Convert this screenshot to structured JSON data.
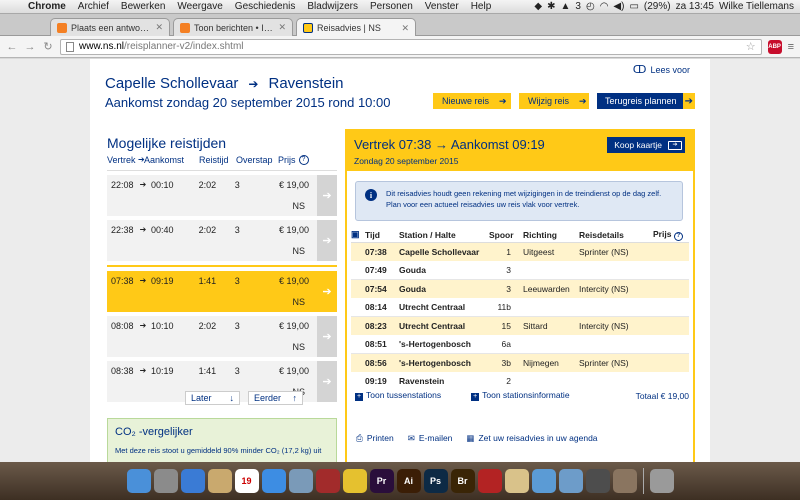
{
  "menubar": {
    "items": [
      "Chrome",
      "Archief",
      "Bewerken",
      "Weergave",
      "Geschiedenis",
      "Bladwijzers",
      "Personen",
      "Venster",
      "Help"
    ],
    "battery": "(29%)",
    "clock": "za 13:45",
    "user": "Wilke Tiellemans",
    "badge_count": "3"
  },
  "tabs": [
    {
      "title": "Plaats een antwoord • Bok",
      "favicon": "stackoverflow-icon",
      "active": false
    },
    {
      "title": "Toon berichten • Instelling",
      "favicon": "stackoverflow-icon",
      "active": false
    },
    {
      "title": "Reisadvies | NS",
      "favicon": "ns-icon",
      "active": true
    }
  ],
  "address": {
    "host": "www.ns.nl",
    "path": "/reisplanner-v2/index.shtml",
    "abp_label": "ABP"
  },
  "page": {
    "lees_voor": "Lees voor",
    "from": "Capelle Schollevaar",
    "to": "Ravenstein",
    "arrival": "Aankomst zondag 20 september 2015 rond 10:00",
    "buttons": {
      "nieuwe": "Nieuwe reis",
      "wijzig": "Wijzig reis",
      "terug": "Terugreis plannen"
    },
    "left": {
      "title": "Mogelijke reistijden",
      "heads": {
        "vertrek": "Vertrek",
        "aankomst": "Aankomst",
        "reistijd": "Reistijd",
        "overstap": "Overstap",
        "prijs": "Prijs"
      },
      "options": [
        {
          "dep": "22:08",
          "arr": "00:10",
          "time": "2:02",
          "transfers": "3",
          "price": "€ 19,00",
          "op": "NS"
        },
        {
          "dep": "22:38",
          "arr": "00:40",
          "time": "2:02",
          "transfers": "3",
          "price": "€ 19,00",
          "op": "NS"
        },
        {
          "dep": "07:38",
          "arr": "09:19",
          "time": "1:41",
          "transfers": "3",
          "price": "€ 19,00",
          "op": "NS"
        },
        {
          "dep": "08:08",
          "arr": "10:10",
          "time": "2:02",
          "transfers": "3",
          "price": "€ 19,00",
          "op": "NS"
        },
        {
          "dep": "08:38",
          "arr": "10:19",
          "time": "1:41",
          "transfers": "3",
          "price": "€ 19,00",
          "op": "NS"
        }
      ],
      "later": "Later",
      "eerder": "Eerder"
    },
    "co2": {
      "title": "CO₂ -vergelijker",
      "text": "Met deze reis stoot u gemiddeld 90% minder CO₂ (17,2 kg) uit"
    },
    "panel": {
      "title": "Vertrek 07:38 → Aankomst 09:19",
      "date": "Zondag 20 september 2015",
      "koop": "Koop kaartje",
      "notice": "Dit reisadvies houdt geen rekening met wijzigingen in de treindienst op de dag zelf. Plan voor een actueel reisadvies uw reis vlak voor vertrek.",
      "heads": {
        "tijd": "Tijd",
        "station": "Station / Halte",
        "spoor": "Spoor",
        "richting": "Richting",
        "details": "Reisdetails",
        "prijs": "Prijs"
      },
      "stops": [
        {
          "time": "07:38",
          "station": "Capelle Schollevaar",
          "spoor": "1",
          "richting": "Uitgeest",
          "details": "Sprinter (NS)",
          "hl": true
        },
        {
          "time": "07:49",
          "station": "Gouda",
          "spoor": "3",
          "richting": "",
          "details": "",
          "hl": false
        },
        {
          "time": "07:54",
          "station": "Gouda",
          "spoor": "3",
          "richting": "Leeuwarden",
          "details": "Intercity (NS)",
          "hl": true
        },
        {
          "time": "08:14",
          "station": "Utrecht Centraal",
          "spoor": "11b",
          "richting": "",
          "details": "",
          "hl": false
        },
        {
          "time": "08:23",
          "station": "Utrecht Centraal",
          "spoor": "15",
          "richting": "Sittard",
          "details": "Intercity (NS)",
          "hl": true
        },
        {
          "time": "08:51",
          "station": "'s-Hertogenbosch",
          "spoor": "6a",
          "richting": "",
          "details": "",
          "hl": false
        },
        {
          "time": "08:56",
          "station": "'s-Hertogenbosch",
          "spoor": "3b",
          "richting": "Nijmegen",
          "details": "Sprinter (NS)",
          "hl": true
        },
        {
          "time": "09:19",
          "station": "Ravenstein",
          "spoor": "2",
          "richting": "",
          "details": "",
          "hl": false
        }
      ],
      "toon_tussen": "Toon tussenstations",
      "toon_info": "Toon stationsinformatie",
      "totaal": "Totaal € 19,00"
    },
    "actions": {
      "print": "Printen",
      "mail": "E-mailen",
      "agenda": "Zet uw reisadvies in uw agenda"
    }
  },
  "dock": [
    {
      "icon": "finder-icon",
      "color": "#4a90d9",
      "label": ""
    },
    {
      "icon": "mail-stamp-icon",
      "color": "#8b8b8b",
      "label": ""
    },
    {
      "icon": "app-store-icon",
      "color": "#3a7bd5",
      "label": ""
    },
    {
      "icon": "contacts-icon",
      "color": "#c9a96e",
      "label": ""
    },
    {
      "icon": "calendar-icon",
      "color": "#ffffff",
      "label": "19"
    },
    {
      "icon": "itunes-icon",
      "color": "#3d8de3",
      "label": ""
    },
    {
      "icon": "preview-icon",
      "color": "#7a9ab8",
      "label": ""
    },
    {
      "icon": "photobooth-icon",
      "color": "#a22b2b",
      "label": ""
    },
    {
      "icon": "chrome-icon",
      "color": "#e5c12f",
      "label": ""
    },
    {
      "icon": "premiere-icon",
      "color": "#2a0e3b",
      "label": "Pr"
    },
    {
      "icon": "illustrator-icon",
      "color": "#3b1e06",
      "label": "Ai"
    },
    {
      "icon": "photoshop-icon",
      "color": "#0d2a45",
      "label": "Ps"
    },
    {
      "icon": "bridge-icon",
      "color": "#3a2506",
      "label": "Br"
    },
    {
      "icon": "filezilla-icon",
      "color": "#b32323",
      "label": ""
    },
    {
      "icon": "notes-icon",
      "color": "#d9c28a",
      "label": ""
    },
    {
      "icon": "safari-icon",
      "color": "#5b9bd5",
      "label": ""
    },
    {
      "icon": "migration-icon",
      "color": "#6d9cc9",
      "label": ""
    },
    {
      "icon": "quicktime-icon",
      "color": "#4d4d4d",
      "label": ""
    },
    {
      "icon": "downloads-icon",
      "color": "#8a7560",
      "label": ""
    },
    {
      "icon": "trash-icon",
      "color": "#9a9a9a",
      "label": ""
    }
  ]
}
